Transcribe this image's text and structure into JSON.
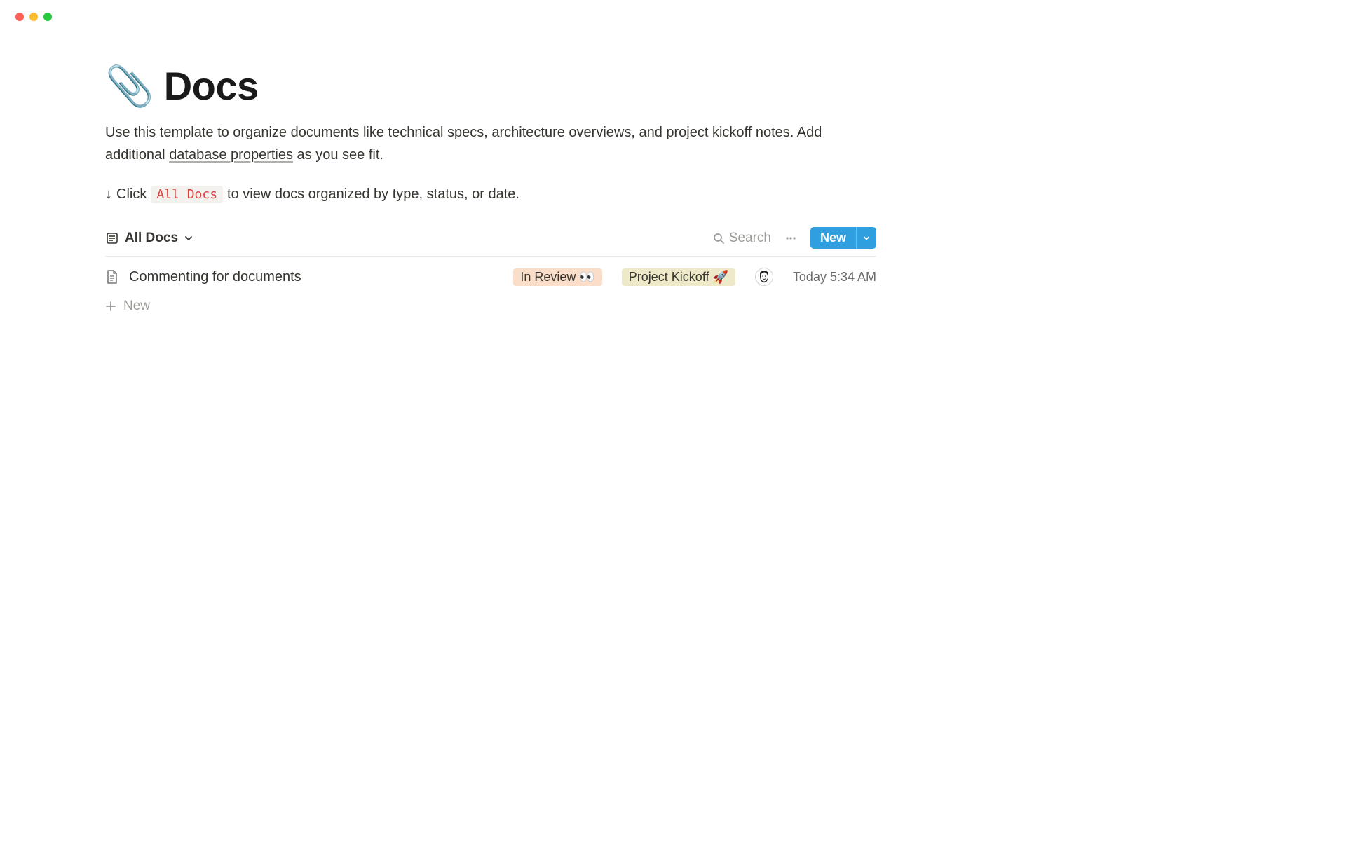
{
  "header": {
    "icon": "📎",
    "title": "Docs"
  },
  "description": {
    "text_before": "Use this template to organize documents like technical specs, architecture overviews, and project kickoff notes. Add additional ",
    "link_text": "database properties",
    "text_after": " as you see fit."
  },
  "hint": {
    "arrow": "↓",
    "prefix": "Click",
    "chip": "All Docs",
    "suffix": "to view docs organized by type, status, or date."
  },
  "viewbar": {
    "view_name": "All Docs",
    "search_label": "Search",
    "new_label": "New"
  },
  "rows": [
    {
      "title": "Commenting for documents",
      "status": "In Review 👀",
      "category": "Project Kickoff 🚀",
      "timestamp": "Today 5:34 AM"
    }
  ],
  "new_row_label": "New"
}
